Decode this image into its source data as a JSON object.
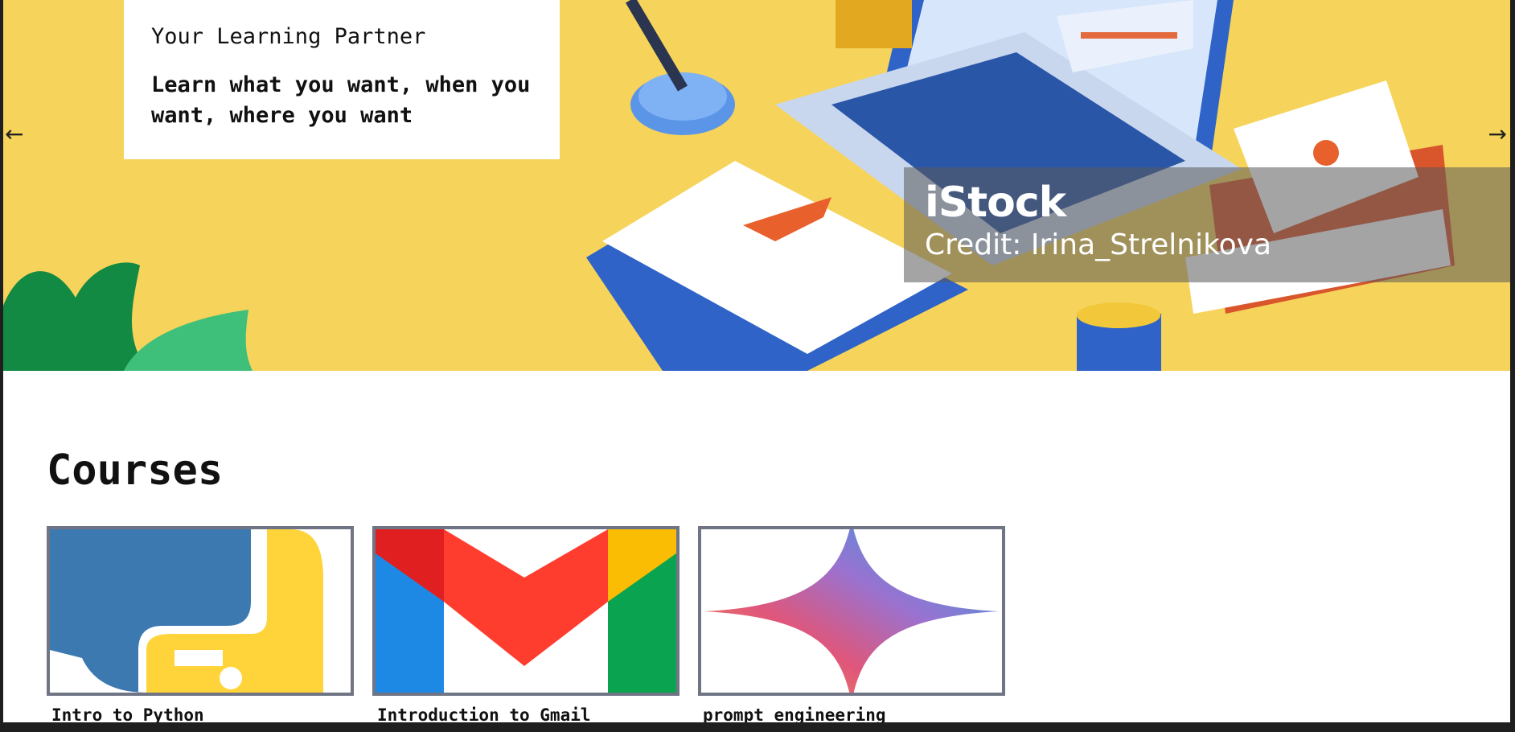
{
  "hero": {
    "caption_title": "Your Learning Partner",
    "caption_text": "Learn what you want, when you want, where you want",
    "prev_arrow": "←",
    "next_arrow": "→",
    "watermark_brand": "iStock",
    "watermark_credit": "Credit: Irina_Strelnikova",
    "background_color": "#f6d35a"
  },
  "courses": {
    "heading": "Courses",
    "items": [
      {
        "title": "Intro to Python",
        "icon": "python-logo-icon"
      },
      {
        "title": "Introduction to Gmail",
        "icon": "gmail-logo-icon"
      },
      {
        "title": "prompt engineering",
        "icon": "gemini-sparkle-icon"
      }
    ]
  }
}
